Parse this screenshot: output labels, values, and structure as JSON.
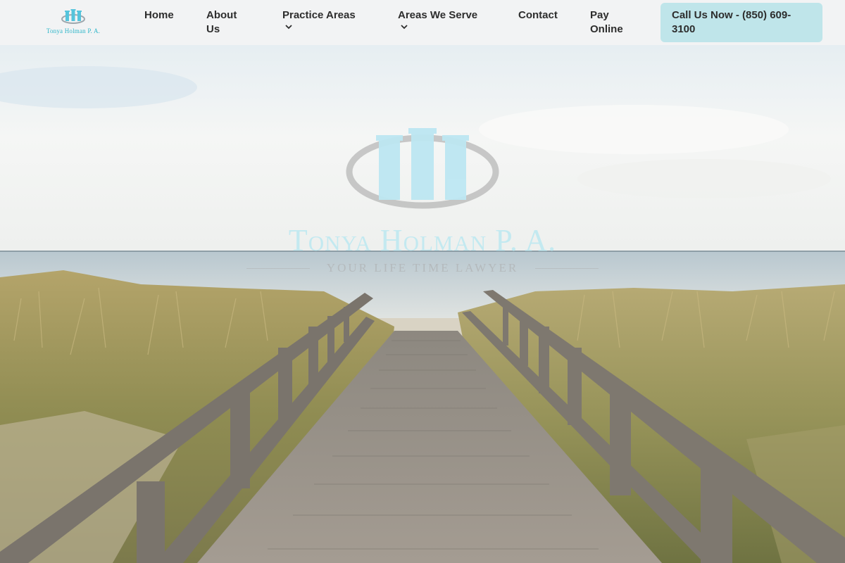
{
  "brand": {
    "name": "Tonya Holman P. A.",
    "logo_icon": "columns-logo-icon"
  },
  "nav": {
    "home": "Home",
    "about": "About Us",
    "practice_areas": "Practice Areas",
    "areas_we_serve": "Areas We Serve",
    "contact": "Contact",
    "pay_online": "Pay Online",
    "dropdown_icon": "chevron-down-icon"
  },
  "cta": {
    "label": "Call Us Now - (850) 609-3100"
  },
  "hero": {
    "title": "Tonya Holman P. A.",
    "tagline": "YOUR LIFE TIME LAWYER",
    "background": "beach-boardwalk-image"
  },
  "colors": {
    "brand_teal": "#2fb6c9",
    "cta_bg": "#bfe5ea",
    "header_bg": "#f2f3f4",
    "text_dark": "#2d2d2d"
  }
}
